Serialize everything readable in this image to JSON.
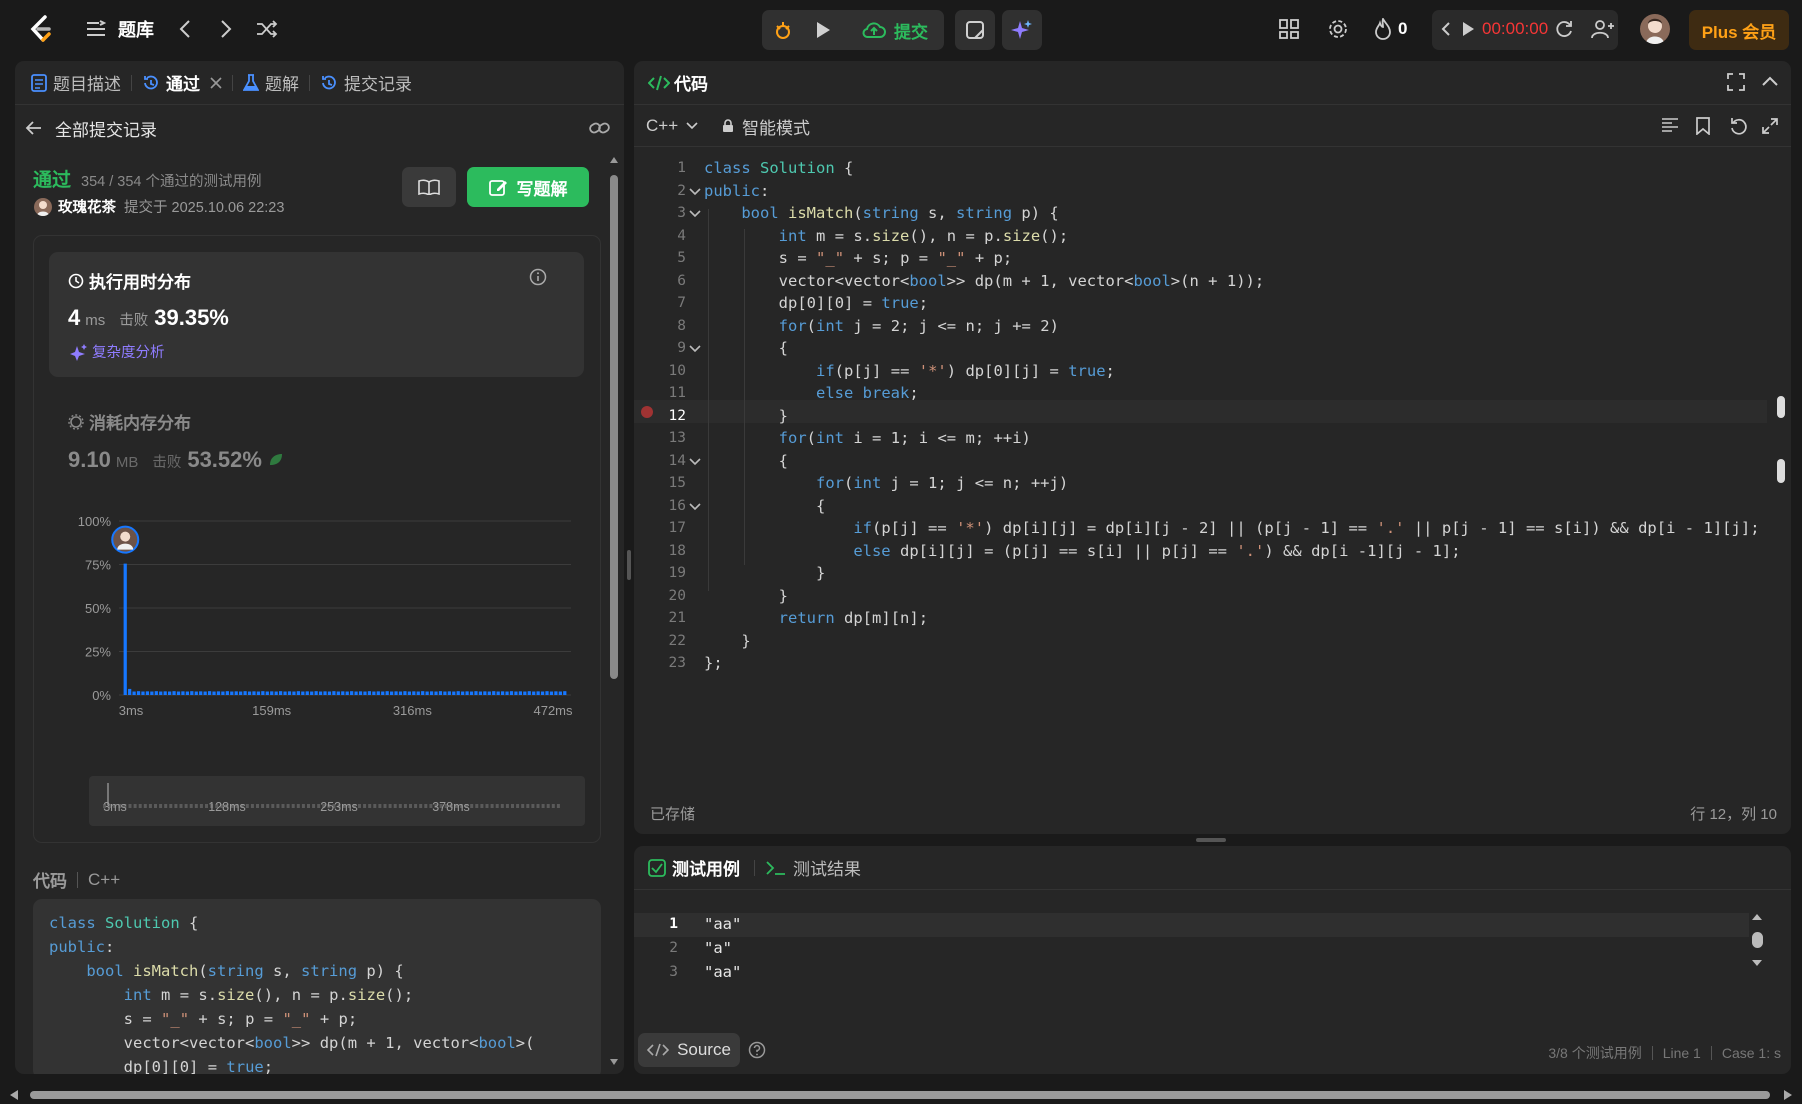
{
  "topbar": {
    "logo": "leetcode-logo",
    "problem_bank": "题库",
    "submit_label": "提交",
    "fire_count": "0",
    "timer": "00:00:00",
    "plus_label": "Plus 会员"
  },
  "left_tabs": [
    {
      "label": "题目描述",
      "icon": "doc-icon"
    },
    {
      "label": "通过",
      "icon": "history-icon"
    },
    {
      "label": "题解",
      "icon": "flask-icon"
    },
    {
      "label": "提交记录",
      "icon": "history-icon"
    }
  ],
  "submission": {
    "back_label": "全部提交记录",
    "status": "通过",
    "cases": "354 / 354 个通过的测试用例",
    "user": "玫瑰花茶",
    "submitted_at": "提交于 2025.10.06 22:23",
    "write_solution": "写题解",
    "runtime_title": "执行用时分布",
    "runtime_value": "4",
    "runtime_unit": "ms",
    "beat_label": "击败",
    "runtime_beat": "39.35%",
    "complexity_label": "复杂度分析",
    "memory_title": "消耗内存分布",
    "memory_value": "9.10",
    "memory_unit": "MB",
    "memory_beat": "53.52%",
    "code_label": "代码",
    "code_lang": "C++"
  },
  "chart_data": {
    "type": "bar",
    "ytick_labels": [
      "100%",
      "75%",
      "50%",
      "25%",
      "0%"
    ],
    "xtick_labels": [
      "3ms",
      "159ms",
      "316ms",
      "472ms"
    ],
    "ylim": [
      0,
      100
    ],
    "values": [
      75.5,
      3.5,
      2.0,
      2.2,
      2.0,
      2.1,
      2.0,
      2.2,
      2.0,
      2.1,
      2.0,
      2.2,
      2.0,
      2.1,
      2.0,
      2.2,
      2.0,
      2.1,
      2.0,
      2.2,
      2.0,
      2.1,
      2.0,
      2.2,
      2.0,
      2.1,
      2.0,
      2.2,
      2.0,
      2.1,
      2.0,
      2.2,
      2.0,
      2.1,
      2.0,
      2.2,
      2.0,
      2.1,
      2.0,
      2.2,
      2.0,
      2.1,
      2.0,
      2.2,
      2.0,
      2.1,
      2.0,
      2.2,
      2.0,
      2.1,
      2.0,
      2.2,
      2.0,
      2.1,
      2.0,
      2.2,
      2.0,
      2.1,
      2.0,
      2.2,
      2.0,
      2.1,
      2.0,
      2.2,
      2.0,
      2.1,
      2.0,
      2.2,
      2.0,
      2.1,
      2.0,
      2.2,
      2.0,
      2.1,
      2.0,
      2.2,
      2.0,
      2.1,
      2.0,
      2.2,
      2.0,
      2.1,
      2.0,
      2.2,
      2.0,
      2.1,
      2.0,
      2.2,
      2.0,
      2.1,
      2.0,
      2.2,
      2.0,
      2.1,
      2.0,
      2.2,
      2.0,
      2.1,
      2.0,
      2.2
    ],
    "brush_labels": [
      "3ms",
      "128ms",
      "253ms",
      "378ms"
    ],
    "grid": true,
    "bar_color": "#1677ff"
  },
  "code_preview": [
    "class Solution {",
    "public:",
    "    bool isMatch(string s, string p) {",
    "        int m = s.size(), n = p.size();",
    "        s = \"_\" + s; p = \"_\" + p;",
    "        vector<vector<bool>> dp(m + 1, vector<bool>(",
    "        dp[0][0] = true;"
  ],
  "editor": {
    "title": "代码",
    "lang": "C++",
    "mode": "智能模式",
    "saved": "已存储",
    "cursor": "行 12，列 10",
    "lines": [
      "class Solution {",
      "public:",
      "    bool isMatch(string s, string p) {",
      "        int m = s.size(), n = p.size();",
      "        s = \"_\" + s; p = \"_\" + p;",
      "        vector<vector<bool>> dp(m + 1, vector<bool>(n + 1));",
      "        dp[0][0] = true;",
      "        for(int j = 2; j <= n; j += 2)",
      "        {",
      "            if(p[j] == '*') dp[0][j] = true;",
      "            else break;",
      "        }",
      "        for(int i = 1; i <= m; ++i)",
      "        {",
      "            for(int j = 1; j <= n; ++j)",
      "            {",
      "                if(p[j] == '*') dp[i][j] = dp[i][j - 2] || (p[j - 1] == '.' || p[j - 1] == s[i]) && dp[i - 1][j];",
      "                else dp[i][j] = (p[j] == s[i] || p[j] == '.') && dp[i -1][j - 1];",
      "            }",
      "        }",
      "        return dp[m][n];",
      "    }",
      "};"
    ],
    "line_numbers": [
      "1",
      "2",
      "3",
      "4",
      "5",
      "6",
      "7",
      "8",
      "9",
      "10",
      "11",
      "12",
      "13",
      "14",
      "15",
      "16",
      "17",
      "18",
      "19",
      "20",
      "21",
      "22",
      "23"
    ]
  },
  "testcases": {
    "tab_cases": "测试用例",
    "tab_result": "测试结果",
    "lines": [
      "\"aa\"",
      "\"a\"",
      "\"aa\""
    ],
    "line_numbers": [
      "1",
      "2",
      "3"
    ],
    "source_label": "Source",
    "status_cases": "3/8 个测试用例",
    "status_line": "Line 1",
    "status_case": "Case 1: s"
  }
}
